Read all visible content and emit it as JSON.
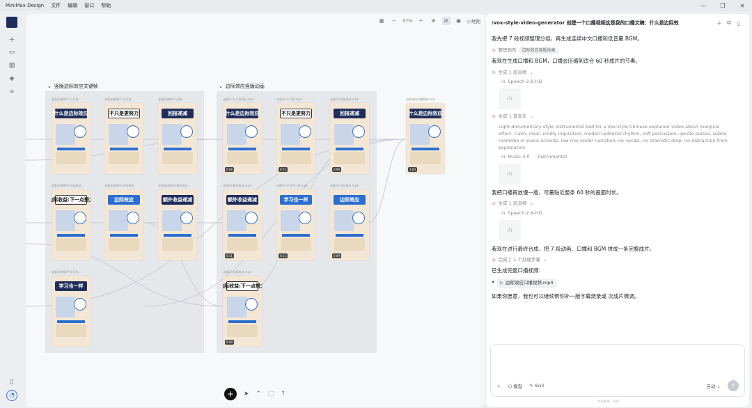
{
  "titlebar": {
    "app_name": "MiniMax Design",
    "menus": [
      "文件",
      "编辑",
      "窗口",
      "帮助"
    ],
    "controls": [
      "—",
      "❐",
      "✕"
    ]
  },
  "sidebar": {
    "icons": [
      "thumbnail-icon",
      "plus-icon",
      "folder-icon",
      "library-icon",
      "plugin-icon",
      "link-icon",
      "phone-icon",
      "user-icon"
    ]
  },
  "canvas": {
    "zoom": "57%",
    "minimap_label": "小地图",
    "groups": [
      {
        "title": "竖版边际效应关键帧"
      },
      {
        "title": "边际效应竖版动画"
      }
    ],
    "cards": [
      {
        "title": "什么是边际效应",
        "style": "dark",
        "label": "竖版关键帧01-什么是..."
      },
      {
        "title": "不只是更努力",
        "style": "light",
        "label": "竖版关键帧02-不只是..."
      },
      {
        "title": "回报递减",
        "style": "dark",
        "label": "竖版关键帧03-回报..."
      },
      {
        "title": "边际收益:下一点努力",
        "style": "light",
        "label": "竖版关键帧04-边际收益..."
      },
      {
        "title": "边际效应",
        "style": "blue",
        "label": "竖版关键帧05-边际效应"
      },
      {
        "title": "额外收益递减",
        "style": "dark",
        "label": "竖版关键帧06-额外收益..."
      },
      {
        "title": "学习也一样",
        "style": "dark",
        "label": "竖版关键帧07-学习也..."
      },
      {
        "title": "什么是边际效应",
        "style": "dark",
        "label": "动画01-什么是边际.mp4",
        "badge": "0:08"
      },
      {
        "title": "不只是更努力",
        "style": "light",
        "label": "动画02-不只是.mp4",
        "badge": "0:11"
      },
      {
        "title": "回报递减",
        "style": "dark",
        "label": "动画03-回报递减.mp4",
        "badge": "0:09"
      },
      {
        "title": "额外收益递减",
        "style": "dark",
        "label": "动画04-额外收益.mp4",
        "badge": "0:11"
      },
      {
        "title": "学习也一样",
        "style": "blue",
        "label": "动画05-学习也一样.mp4",
        "badge": "0:11"
      },
      {
        "title": "边际效应",
        "style": "blue",
        "label": "动画06-边际效应.mp4",
        "badge": "0:09"
      },
      {
        "title": "边际收益:下一点努力",
        "style": "light",
        "label": "动画07-边际收益.mp4",
        "badge": "0:09"
      },
      {
        "title": "什么是边际效应",
        "style": "dark",
        "label": "边际效应口播视频.mp4",
        "badge": "1:03"
      }
    ],
    "bottom_tools": [
      "+",
      "➤",
      "⌃",
      "🗀",
      "?"
    ]
  },
  "panel": {
    "header": {
      "title": "/vox-style-video-generator 创建一个口播视频这是我的口播文稿：什么是边际效"
    },
    "messages": [
      {
        "type": "text",
        "text": "我先把 7 段视频整理分组，再生成连续中文口播和低音量 BGM。"
      },
      {
        "type": "step",
        "label": "整理画布",
        "chip": "边际效应竖版动画"
      },
      {
        "type": "text",
        "text": "我现在生成口播和 BGM，口播会压缩到适合 60 秒成片的节奏。"
      },
      {
        "type": "step",
        "label": "生成 1 段音频"
      },
      {
        "type": "model",
        "label": "Speech-2.8-HD"
      },
      {
        "type": "audio"
      },
      {
        "type": "step",
        "label": "生成 1 首音乐"
      },
      {
        "type": "desc",
        "text": "Light documentary-style instrumental bed for a Vox-style Chinese explainer video about marginal effect. Calm, clear, mildly inquisitive, modern editorial rhythm, soft percussion, gentle pulses, subtle marimba or piano accents, low-mix under narration, no vocals, no dramatic drop, no distraction from explanation."
      },
      {
        "type": "model",
        "label": "Music-3.0",
        "tag": "instrumental"
      },
      {
        "type": "audio"
      },
      {
        "type": "text",
        "text": "我把口播再放慢一版，尽量贴近整条 60 秒的画面时长。"
      },
      {
        "type": "step",
        "label": "生成 1 段音频"
      },
      {
        "type": "model",
        "label": "Speech-2.8-HD"
      },
      {
        "type": "audio"
      },
      {
        "type": "text",
        "text": "我现在进行最终合成，把 7 段动画、口播和 BGM 拼成一条完整成片。"
      },
      {
        "type": "step",
        "label": "完成了 1 个处理步骤"
      },
      {
        "type": "text",
        "text": "已生成完整口播视频："
      },
      {
        "type": "file",
        "label": "边际效应口播视频.mp4"
      },
      {
        "type": "text",
        "text": "如果你愿意，我也可以继续帮你补一版字幕烧录或 次成片微调。"
      }
    ],
    "input": {
      "model_label": "模型",
      "skill_label": "Skill",
      "mode_label": "自动"
    },
    "footer_note": "体验版本 · 反馈"
  }
}
